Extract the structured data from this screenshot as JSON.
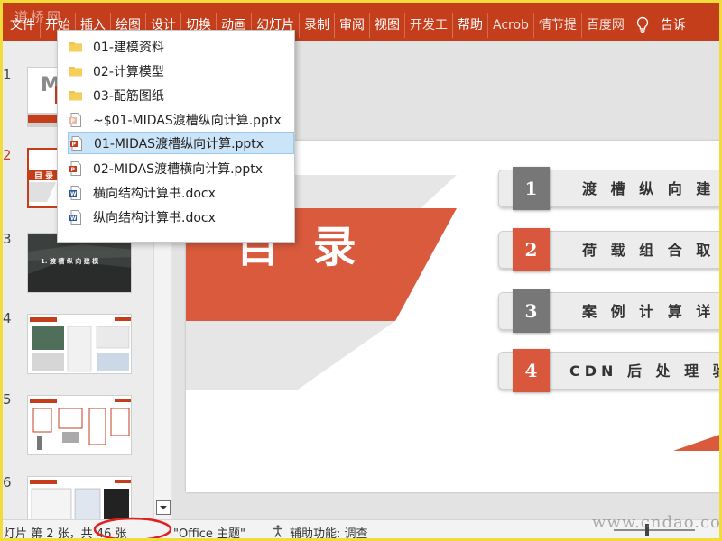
{
  "watermark_top": "道桥网",
  "watermark_bottom": "www.cndao.com",
  "ribbon": {
    "tabs": [
      "文件",
      "开始",
      "插入",
      "绘图",
      "设计",
      "切换",
      "动画",
      "幻灯片",
      "录制",
      "审阅",
      "视图",
      "开发工",
      "帮助",
      "Acrob",
      "情节提",
      "百度网"
    ],
    "tell_me": "告诉"
  },
  "thumbnails": {
    "numbers": [
      "1",
      "2",
      "3",
      "4",
      "5",
      "6"
    ],
    "thumb2_label": "目 录",
    "thumb3_label": "1. 渡 槽 纵 向 建 模"
  },
  "slide": {
    "title": "目 录",
    "items": [
      {
        "num": "1",
        "text": "渡 槽 纵 向 建 模"
      },
      {
        "num": "2",
        "text": "荷 载 组 合 取 值"
      },
      {
        "num": "3",
        "text": "案 例 计 算 详 述"
      },
      {
        "num": "4",
        "text": "CDN 后 处 理 验 算"
      }
    ]
  },
  "file_popup": {
    "items": [
      {
        "label": "01-建模资料",
        "icon": "folder-icon"
      },
      {
        "label": "02-计算模型",
        "icon": "folder-icon"
      },
      {
        "label": "03-配筋图纸",
        "icon": "folder-icon"
      },
      {
        "label": "~$01-MIDAS渡槽纵向计算.pptx",
        "icon": "pptx-temp-file-icon"
      },
      {
        "label": "01-MIDAS渡槽纵向计算.pptx",
        "icon": "pptx-file-icon",
        "selected": true
      },
      {
        "label": "02-MIDAS渡槽横向计算.pptx",
        "icon": "pptx-file-icon"
      },
      {
        "label": "横向结构计算书.docx",
        "icon": "docx-file-icon"
      },
      {
        "label": "纵向结构计算书.docx",
        "icon": "docx-file-icon"
      }
    ]
  },
  "statusbar": {
    "slide_info": "灯片 第 2 张，共 46 张",
    "theme": "\"Office 主题\"",
    "accessibility": "辅助功能: 调查"
  },
  "colors": {
    "accent": "#c43e1c",
    "toc_num_dark": "#777777",
    "toc_num_accent": "#d9583d",
    "popup_selected": "#cce4f7"
  }
}
